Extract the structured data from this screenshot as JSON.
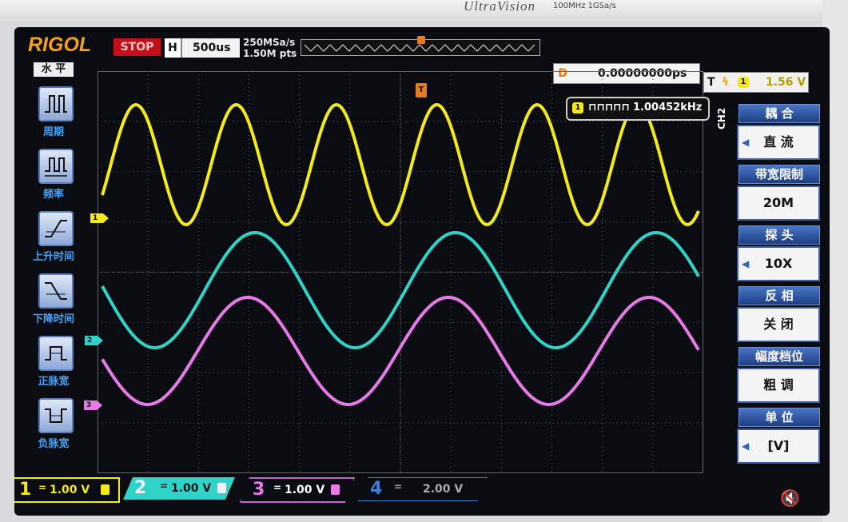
{
  "bezel": {
    "brand": "UltraVision",
    "spec": "100MHz  1GSa/s"
  },
  "topbar": {
    "logo": "RIGOL",
    "run_state": "STOP",
    "timebase_label": "H",
    "timebase_value": "500us",
    "sample_rate": "250MSa/s",
    "memory_depth": "1.50M pts",
    "delay_label": "D",
    "delay_value": "0.00000000ps",
    "trigger_label": "T",
    "trigger_edge": "ϟ",
    "trigger_channel": "1",
    "trigger_level": "1.56 V"
  },
  "frequency_counter": {
    "channel": "1",
    "symbol": "⊓⊓⊓⊓⊓",
    "value": "1.00452kHz"
  },
  "left_menu": {
    "title": "水 平",
    "items": [
      {
        "label": "周期"
      },
      {
        "label": "频率"
      },
      {
        "label": "上升时间"
      },
      {
        "label": "下降时间"
      },
      {
        "label": "正脉宽"
      },
      {
        "label": "负脉宽"
      }
    ]
  },
  "right_menu": {
    "channel": "CH2",
    "items": [
      {
        "title": "耦 合",
        "value": "直 流"
      },
      {
        "title": "带宽限制",
        "value": "20M"
      },
      {
        "title": "探 头",
        "value": "10X"
      },
      {
        "title": "反 相",
        "value": "关 闭"
      },
      {
        "title": "幅度档位",
        "value": "粗 调"
      },
      {
        "title": "单 位",
        "value": "[V]"
      }
    ]
  },
  "markers": {
    "ch1": "1",
    "ch2": "2",
    "ch3": "3",
    "trigger": "T"
  },
  "channels": [
    {
      "num": "1",
      "coupling": "=",
      "scale": "1.00 V",
      "color": "#f4ea1a"
    },
    {
      "num": "2",
      "coupling": "=",
      "scale": "1.00 V",
      "color": "#2fd3c8"
    },
    {
      "num": "3",
      "coupling": "=",
      "scale": "1.00 V",
      "color": "#e87ae8"
    },
    {
      "num": "4",
      "coupling": "=",
      "scale": "2.00 V",
      "color": "#3b7fd8"
    }
  ],
  "colors": {
    "ch1": "#f4ea1a",
    "ch2": "#2fd3c8",
    "ch3": "#e87ae8",
    "ch4": "#3b7fd8",
    "trigger": "#e67c1f",
    "stop": "#c2111a"
  }
}
